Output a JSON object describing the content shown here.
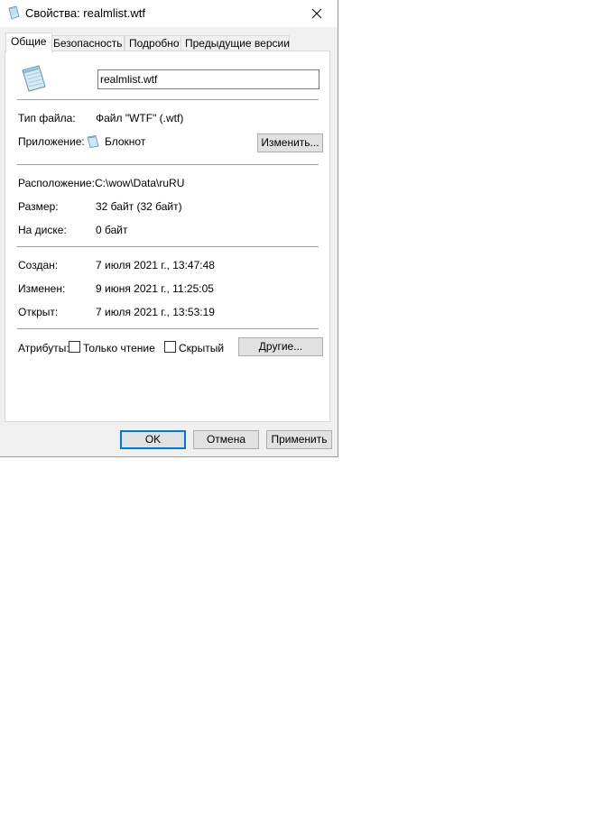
{
  "window": {
    "title": "Свойства: realmlist.wtf",
    "close_glyph": "✕"
  },
  "tabs": [
    {
      "label": "Общие",
      "active": true
    },
    {
      "label": "Безопасность",
      "active": false
    },
    {
      "label": "Подробно",
      "active": false
    },
    {
      "label": "Предыдущие версии",
      "active": false
    }
  ],
  "general": {
    "file_name": "realmlist.wtf",
    "file_type_label": "Тип файла:",
    "file_type_value": "Файл \"WTF\" (.wtf)",
    "app_label": "Приложение:",
    "app_value": "Блокнот",
    "change_button": "Изменить...",
    "location_label": "Расположение:",
    "location_value": "C:\\wow\\Data\\ruRU",
    "size_label": "Размер:",
    "size_value": "32 байт (32 байт)",
    "disk_label": "На диске:",
    "disk_value": "0 байт",
    "created_label": "Создан:",
    "created_value": "7 июля 2021 г., 13:47:48",
    "modified_label": "Изменен:",
    "modified_value": "9 июня 2021 г., 11:25:05",
    "opened_label": "Открыт:",
    "opened_value": "7 июля 2021 г., 13:53:19",
    "attributes_label": "Атрибуты:",
    "readonly_label": "Только чтение",
    "readonly_checked": false,
    "hidden_label": "Скрытый",
    "hidden_checked": false,
    "other_button": "Другие..."
  },
  "footer": {
    "ok": "OK",
    "cancel": "Отмена",
    "apply": "Применить"
  },
  "icons": {
    "title": "notepad-document-icon",
    "file": "notepad-document-icon",
    "app": "notepad-icon",
    "close": "close-icon"
  },
  "colors": {
    "window_bg": "#f0f0f0",
    "panel_bg": "#ffffff",
    "accent": "#0078d7"
  }
}
